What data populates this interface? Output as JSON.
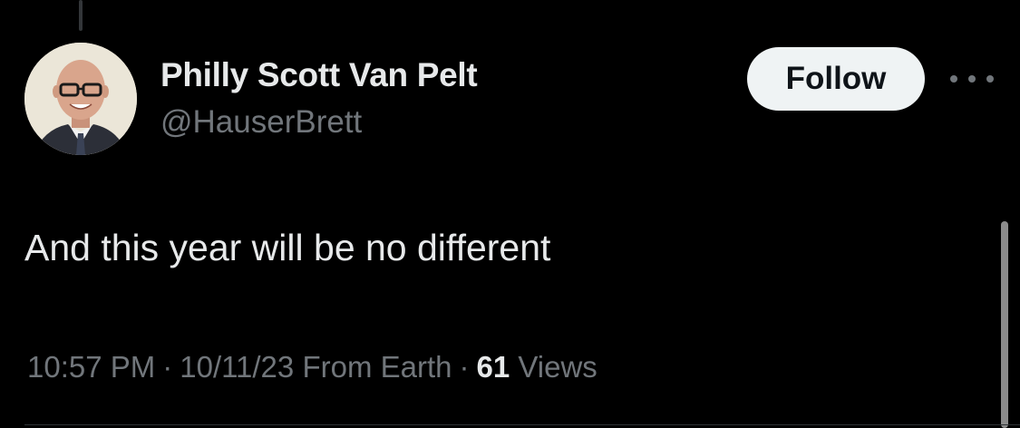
{
  "tweet": {
    "author": {
      "display_name": "Philly Scott Van Pelt",
      "handle": "@HauserBrett",
      "avatar_icon": "profile-photo"
    },
    "follow_label": "Follow",
    "more_icon": "more-horizontal-icon",
    "text": "And this year will be no different",
    "meta": {
      "time": "10:57 PM",
      "date": "10/11/23",
      "location": "From Earth",
      "separator": "·",
      "views_count": "61",
      "views_label": "Views"
    }
  },
  "colors": {
    "background": "#000000",
    "primary_text": "#e7e9ea",
    "secondary_text": "#71767b",
    "button_bg": "#eff3f4",
    "button_text": "#0f1419"
  }
}
